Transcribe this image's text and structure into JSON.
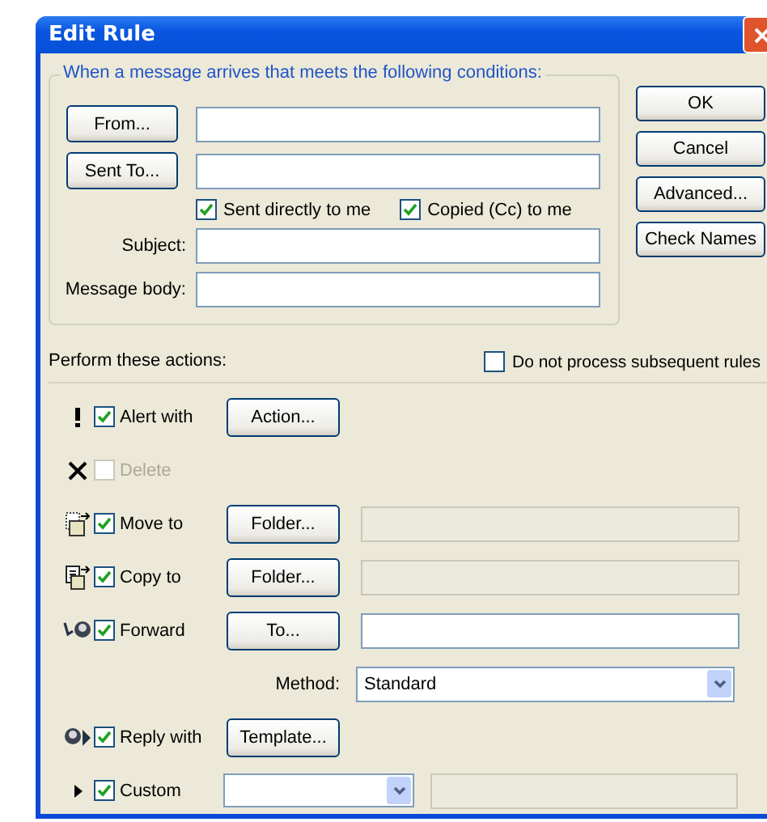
{
  "window": {
    "title": "Edit Rule"
  },
  "conditions": {
    "legend": "When a message arrives that meets the following conditions:",
    "address_rows": [
      {
        "button": "From..."
      },
      {
        "button": "Sent To..."
      }
    ],
    "checkboxes": [
      {
        "label": "Sent directly to me",
        "checked": true
      },
      {
        "label": "Copied (Cc) to me",
        "checked": true
      }
    ],
    "text_rows": [
      {
        "label": "Subject:"
      },
      {
        "label": "Message body:"
      }
    ]
  },
  "side_buttons": [
    "OK",
    "Cancel",
    "Advanced...",
    "Check Names"
  ],
  "actions_heading": "Perform these actions:",
  "stop_option": {
    "label": "Do not process subsequent rules",
    "checked": false
  },
  "actions": [
    {
      "kind": "alert",
      "label": "Alert with",
      "checked": true,
      "disabled": false,
      "button": "Action..."
    },
    {
      "kind": "delete",
      "label": "Delete",
      "checked": false,
      "disabled": true
    },
    {
      "kind": "move",
      "label": "Move to",
      "checked": true,
      "disabled": false,
      "button": "Folder...",
      "field": {
        "disabled": true
      }
    },
    {
      "kind": "copy",
      "label": "Copy to",
      "checked": true,
      "disabled": false,
      "button": "Folder...",
      "field": {
        "disabled": true
      }
    },
    {
      "kind": "forward",
      "label": "Forward",
      "checked": true,
      "disabled": false,
      "button": "To...",
      "field": {
        "disabled": false
      }
    },
    {
      "kind": "method",
      "label": "Method:",
      "value": "Standard"
    },
    {
      "kind": "reply",
      "label": "Reply with",
      "checked": true,
      "disabled": false,
      "button": "Template..."
    },
    {
      "kind": "custom",
      "label": "Custom",
      "checked": true,
      "disabled": false,
      "field": {
        "disabled": true
      }
    }
  ]
}
